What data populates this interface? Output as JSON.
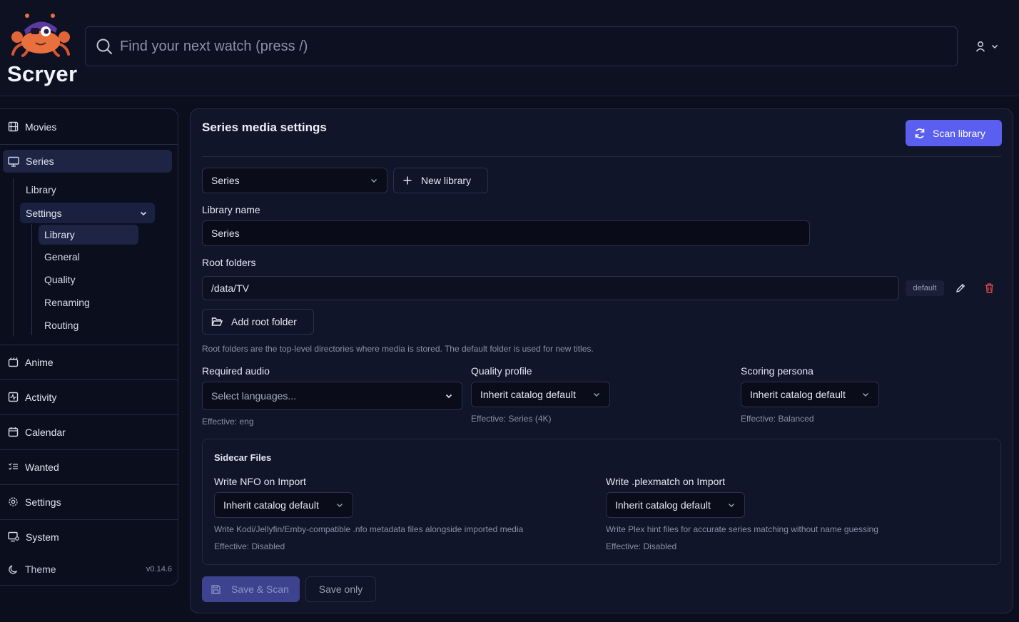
{
  "app": {
    "name": "Scryer",
    "version": "v0.14.6"
  },
  "search": {
    "placeholder": "Find your next watch (press /)"
  },
  "sidebar": {
    "movies": "Movies",
    "series": "Series",
    "series_library": "Library",
    "series_settings": "Settings",
    "settings_items": [
      "Library",
      "General",
      "Quality",
      "Renaming",
      "Routing"
    ],
    "anime": "Anime",
    "activity": "Activity",
    "calendar": "Calendar",
    "wanted": "Wanted",
    "settings": "Settings",
    "system": "System",
    "theme": "Theme"
  },
  "main": {
    "title": "Series media settings",
    "scan_button": "Scan library",
    "library_select": "Series",
    "new_library": "New library",
    "library_name_label": "Library name",
    "library_name_value": "Series",
    "root_folders_label": "Root folders",
    "root_folder_path": "/data/TV",
    "root_folder_badge": "default",
    "add_root_folder": "Add root folder",
    "root_folders_hint": "Root folders are the top-level directories where media is stored. The default folder is used for new titles.",
    "required_audio_label": "Required audio",
    "required_audio_placeholder": "Select languages...",
    "required_audio_effective": "Effective: eng",
    "quality_profile_label": "Quality profile",
    "quality_profile_value": "Inherit catalog default",
    "quality_profile_effective": "Effective: Series (4K)",
    "scoring_persona_label": "Scoring persona",
    "scoring_persona_value": "Inherit catalog default",
    "scoring_persona_effective": "Effective: Balanced",
    "sidecar": {
      "title": "Sidecar Files",
      "nfo_label": "Write NFO on Import",
      "nfo_value": "Inherit catalog default",
      "nfo_desc": "Write Kodi/Jellyfin/Emby-compatible .nfo metadata files alongside imported media",
      "nfo_effective": "Effective: Disabled",
      "plex_label": "Write .plexmatch on Import",
      "plex_value": "Inherit catalog default",
      "plex_desc": "Write Plex hint files for accurate series matching without name guessing",
      "plex_effective": "Effective: Disabled"
    },
    "save_scan": "Save & Scan",
    "save_only": "Save only"
  },
  "colors": {
    "accent": "#5b5ff0",
    "background": "#0b0e1c",
    "panel": "#10152a",
    "danger": "#e5484d"
  }
}
